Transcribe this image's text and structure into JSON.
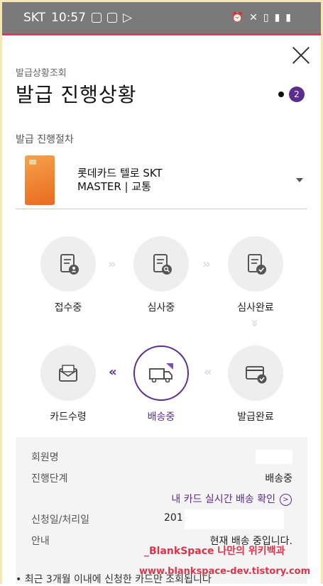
{
  "status_bar": {
    "carrier": "SKT",
    "time": "10:57"
  },
  "header": {
    "breadcrumb": "발급상황조회",
    "title": "발급 진행상황",
    "page_badge": "2"
  },
  "section_label": "발급 진행절차",
  "card": {
    "name_line1": "롯데카드 텔로 SKT",
    "name_line2": "MASTER | 교통"
  },
  "steps": [
    {
      "label": "접수중",
      "icon": "doc-user-icon"
    },
    {
      "label": "심사중",
      "icon": "doc-search-icon"
    },
    {
      "label": "심사완료",
      "icon": "doc-check-icon"
    },
    {
      "label": "발급완료",
      "icon": "card-check-icon"
    },
    {
      "label": "배송중",
      "icon": "truck-icon"
    },
    {
      "label": "카드수령",
      "icon": "envelope-icon"
    }
  ],
  "active_step": "배송중",
  "info": {
    "member_label": "회원명",
    "stage_label": "진행단계",
    "stage_value": "배송중",
    "track_link": "내 카드 실시간 배송 확인",
    "date_label": "신청일/처리일",
    "date_value": "201",
    "guide_label": "안내",
    "guide_value": "현재 배송 중입니다."
  },
  "notice": "• 최근 3개월 이내에 신청한 카드만 조회됩니다",
  "watermark": {
    "line1": "_BlankSpace 나만의 위키백과",
    "line2": "www.blankspace-dev.tistory.com"
  },
  "colors": {
    "accent": "#5b2d8e",
    "status_bar": "#7a7a7a",
    "brand_line": "#e4335c"
  }
}
